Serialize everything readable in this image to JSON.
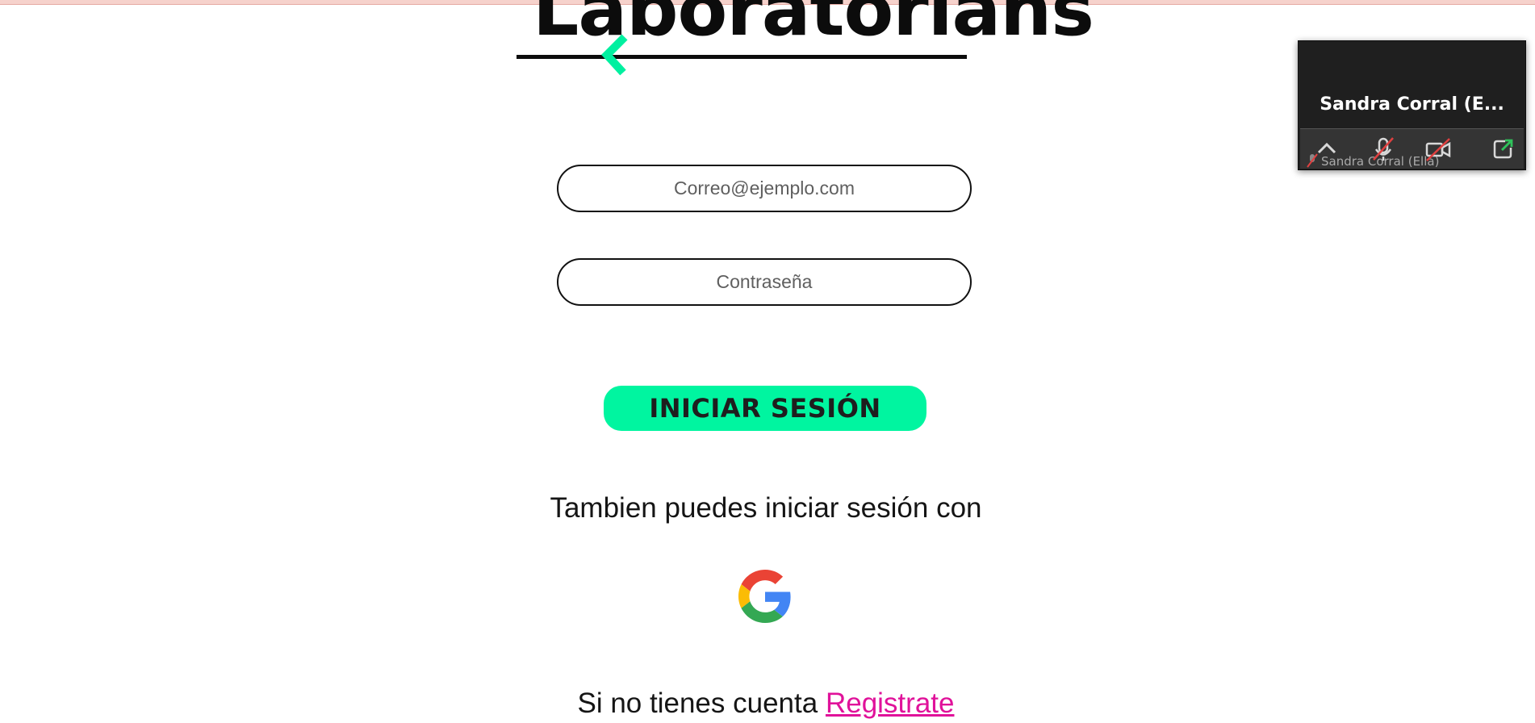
{
  "logo": {
    "title": "Laboratorians"
  },
  "login_form": {
    "email_placeholder": "Correo@ejemplo.com",
    "password_placeholder": "Contraseña",
    "submit_label": "INICIAR SESIÓN"
  },
  "alt_login": {
    "text": "Tambien puedes iniciar sesión con",
    "provider_icon": "google-icon"
  },
  "signup": {
    "prompt": "Si no tienes cuenta",
    "link_label": "Registrate"
  },
  "zoom_window": {
    "participant_name": "Sandra Corral (E...",
    "participant_label": "Sandra Corral (Ella)",
    "controls": [
      "chevron-up-icon",
      "mic-muted-icon",
      "video-off-icon",
      "share-out-icon"
    ]
  },
  "colors": {
    "accent": "#00f5a0",
    "link": "#e0129a",
    "text": "#151515"
  }
}
